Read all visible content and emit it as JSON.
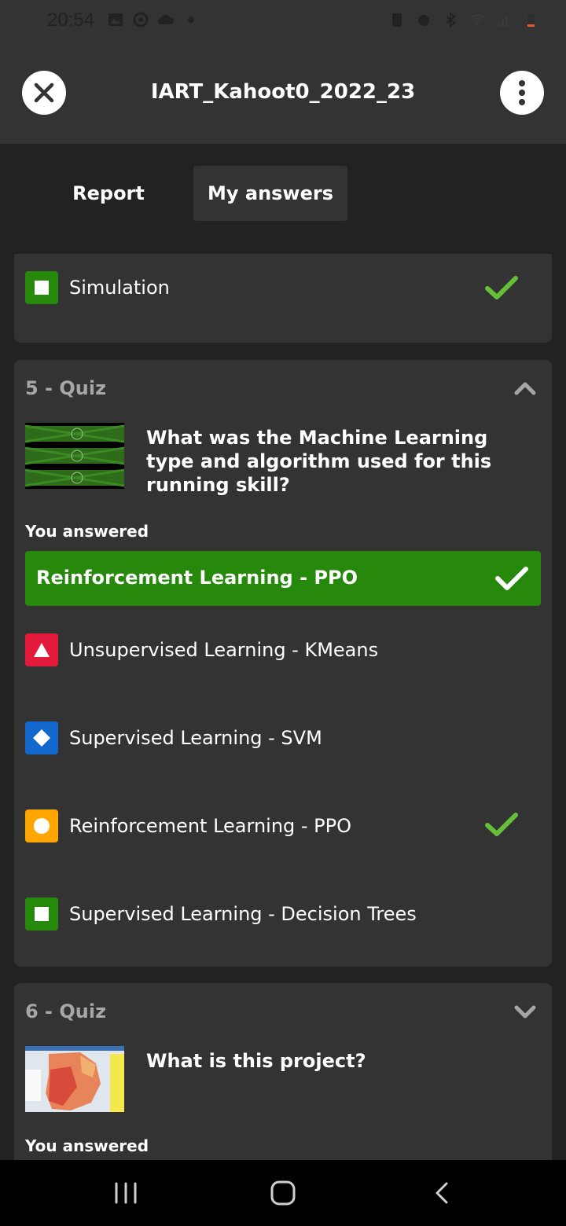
{
  "status_bar": {
    "time": "20:54"
  },
  "header": {
    "title": "IART_Kahoot0_2022_23"
  },
  "tabs": [
    {
      "label": "Report"
    },
    {
      "label": "My answers"
    }
  ],
  "prev_card": {
    "options": [
      {
        "label": "Simulation",
        "shape": "square",
        "color": "#26890c",
        "correct": true
      }
    ]
  },
  "quiz5": {
    "heading": "5 - Quiz",
    "question": "What was the Machine Learning type and algorithm used for this running skill?",
    "you_answered_label": "You answered",
    "selected_answer": "Reinforcement Learning - PPO",
    "options": [
      {
        "label": "Unsupervised Learning - KMeans",
        "shape": "triangle",
        "color": "#e21b3c",
        "correct": false
      },
      {
        "label": "Supervised Learning - SVM",
        "shape": "diamond",
        "color": "#1368ce",
        "correct": false
      },
      {
        "label": "Reinforcement Learning - PPO",
        "shape": "circle",
        "color": "#ffa602",
        "correct": true
      },
      {
        "label": "Supervised Learning - Decision Trees",
        "shape": "square",
        "color": "#26890c",
        "correct": false
      }
    ]
  },
  "quiz6": {
    "heading": "6 - Quiz",
    "question": "What is this project?",
    "you_answered_label": "You answered"
  },
  "colors": {
    "correct_green": "#26890c",
    "check_green": "#66bf39",
    "card_bg": "#333333",
    "page_bg": "#222222"
  }
}
